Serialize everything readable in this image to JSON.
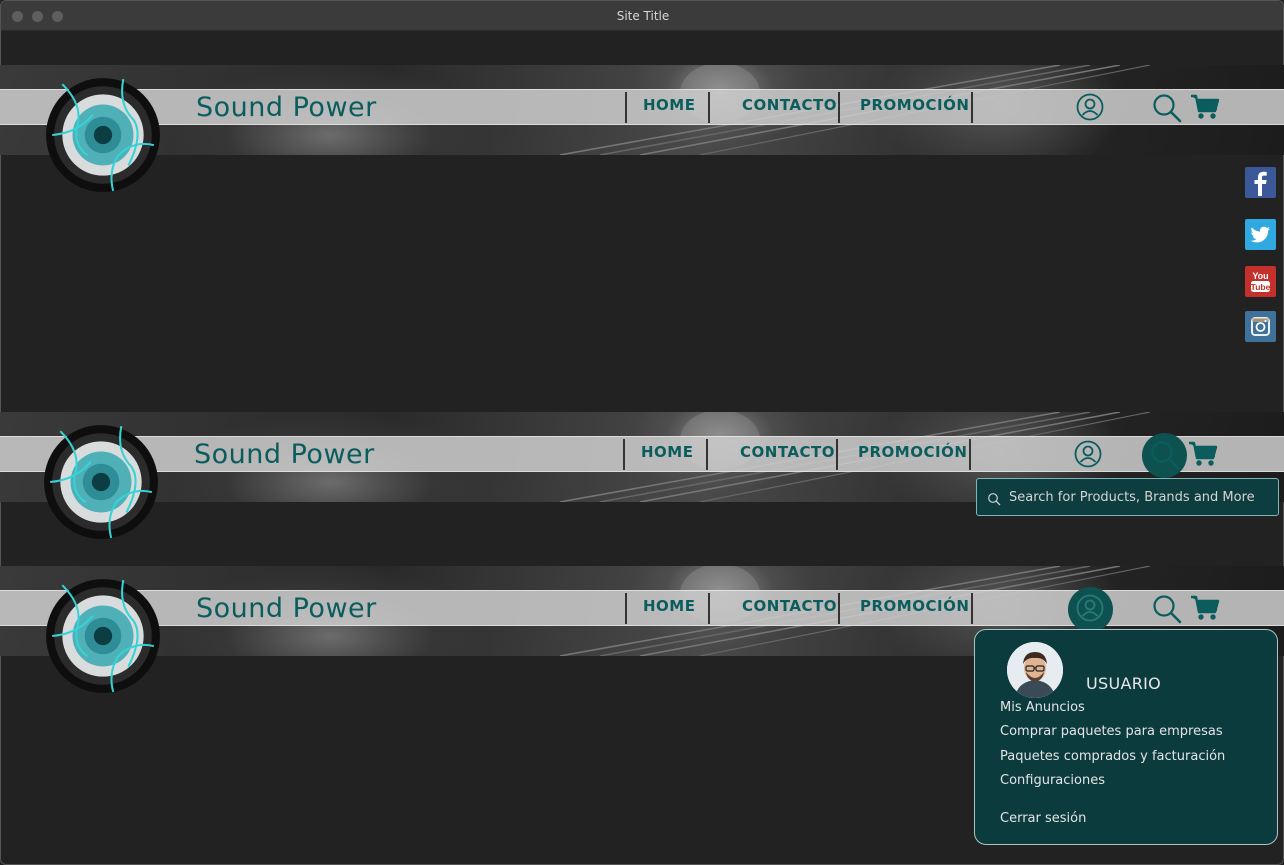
{
  "window": {
    "title": "Site Title"
  },
  "brand": {
    "name": "Sound Power"
  },
  "nav": {
    "home": "HOME",
    "contacto": "CONTACTO",
    "promocion": "PROMOCIÓN"
  },
  "icons": {
    "user": "user-circle-icon",
    "search": "magnifier-icon",
    "cart": "shopping-cart-icon",
    "logo": "speaker-logo-icon"
  },
  "social": [
    {
      "name": "facebook",
      "glyph": "f",
      "color": "#3b5998"
    },
    {
      "name": "twitter",
      "glyph": "twitter-bird-icon",
      "color": "#30a9e0"
    },
    {
      "name": "youtube",
      "glyph": "You Tube",
      "color": "#c4302b"
    },
    {
      "name": "instagram",
      "glyph": "camera-icon",
      "color": "#3f729b"
    }
  ],
  "search": {
    "placeholder": "Search for Products, Brands and More"
  },
  "user_menu": {
    "username": "USUARIO",
    "items": [
      "Mis Anuncios",
      "Comprar paquetes para empresas",
      "Paquetes comprados y facturación",
      "Configuraciones"
    ],
    "logout": "Cerrar sesión"
  },
  "colors": {
    "accent": "#0b5d5d",
    "menu_bg": "#0b3b3d",
    "page_bg": "#222222"
  }
}
